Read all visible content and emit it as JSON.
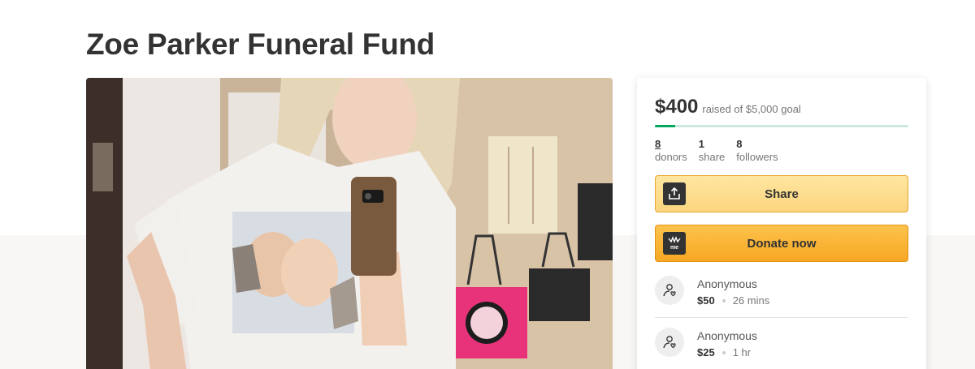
{
  "campaign": {
    "title": "Zoe Parker Funeral Fund"
  },
  "progress": {
    "amount_raised": "$400",
    "goal_text": "raised of $5,000 goal",
    "fraction": 0.08
  },
  "stats": [
    {
      "value": "8",
      "label": "donors"
    },
    {
      "value": "1",
      "label": "share"
    },
    {
      "value": "8",
      "label": "followers"
    }
  ],
  "buttons": {
    "share_label": "Share",
    "donate_label": "Donate now",
    "share_icon": "share-upload-icon",
    "donate_icon": "gofundme-logo-icon"
  },
  "donations": [
    {
      "name": "Anonymous",
      "amount": "$50",
      "time": "26 mins"
    },
    {
      "name": "Anonymous",
      "amount": "$25",
      "time": "1 hr"
    }
  ],
  "colors": {
    "progress_fill": "#02a95c",
    "progress_track": "#cde8dc",
    "share_button": "#fde39a",
    "donate_button": "#f9b132"
  }
}
